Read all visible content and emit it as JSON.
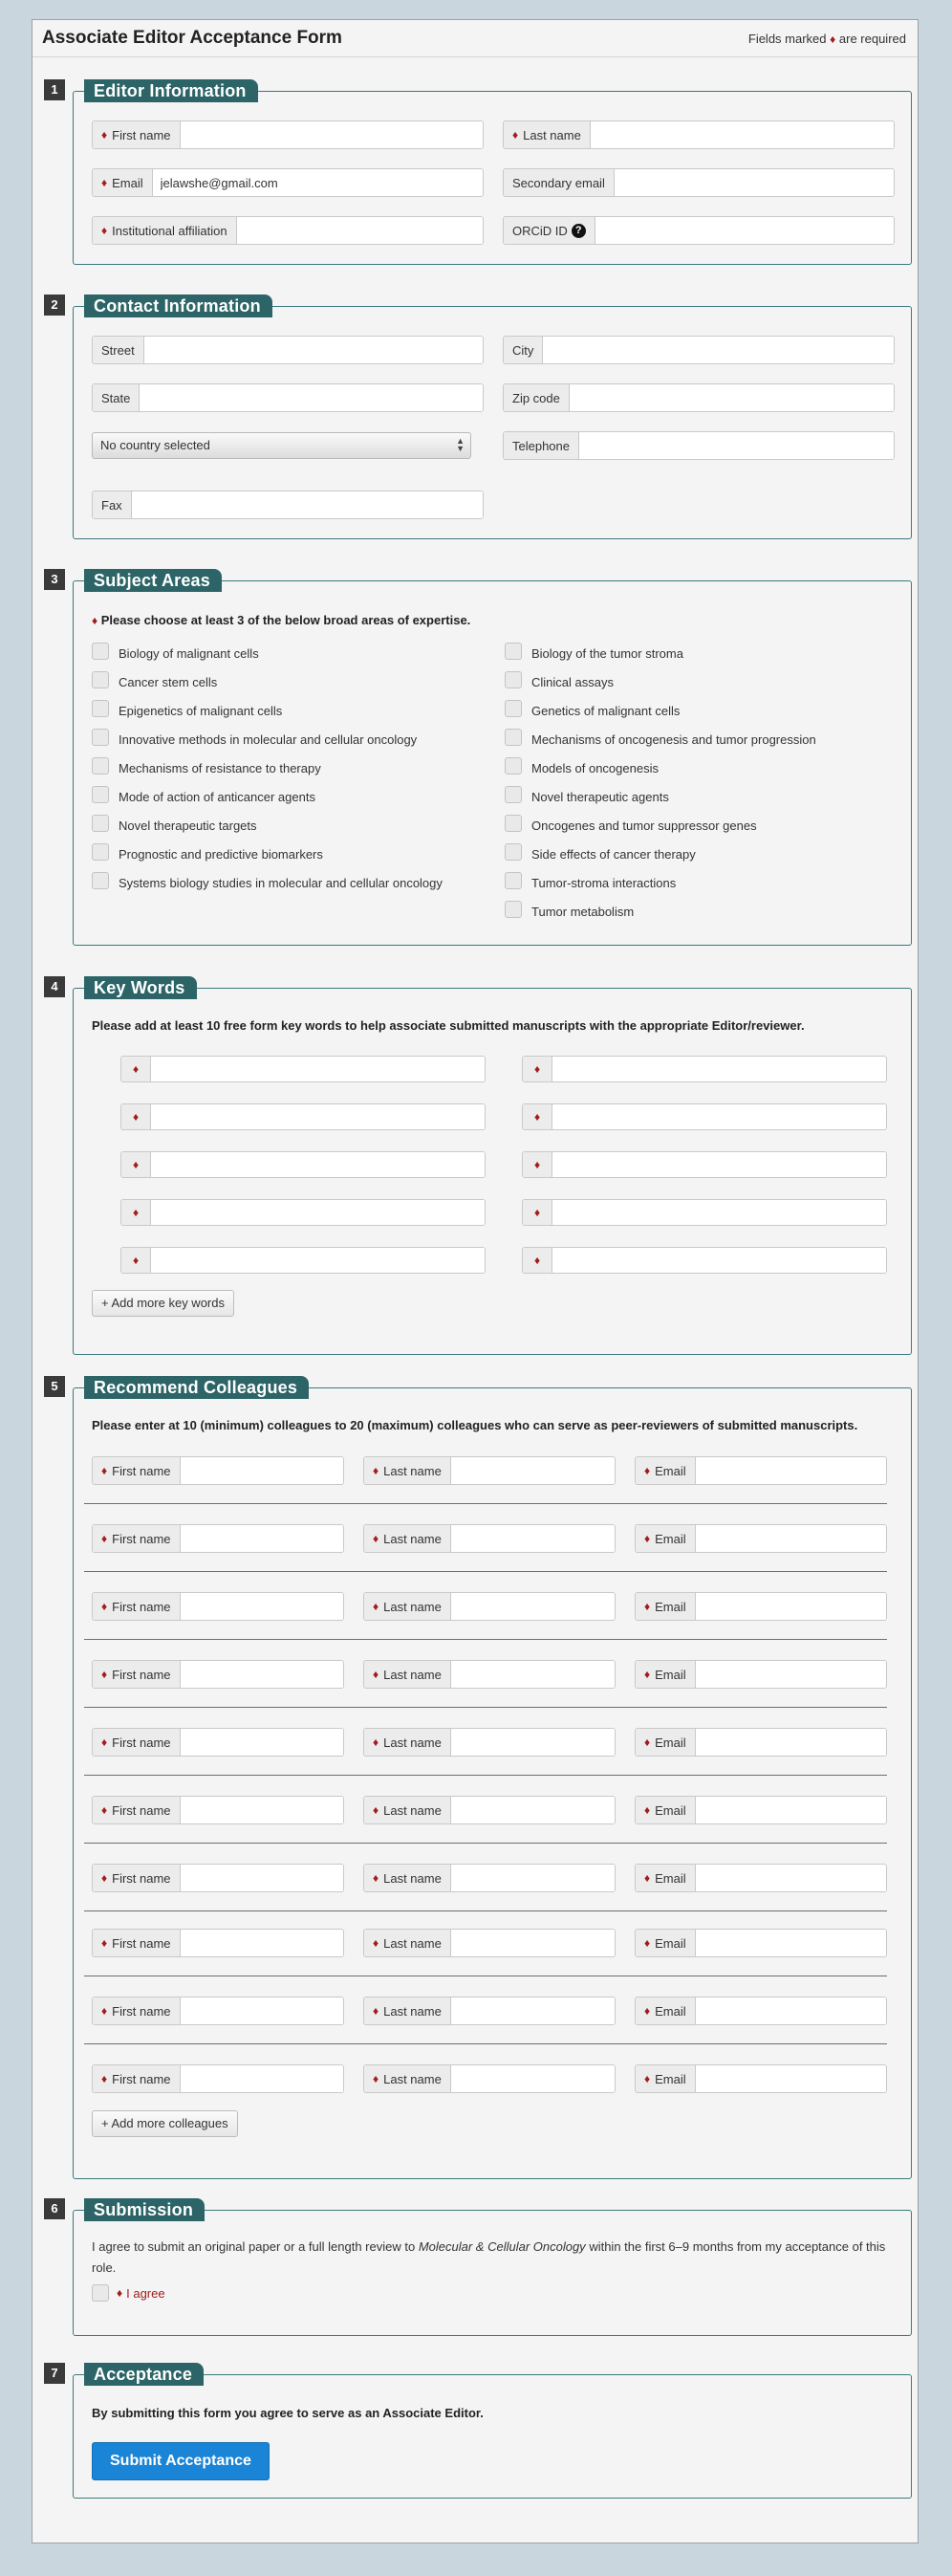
{
  "form": {
    "title": "Associate Editor Acceptance Form",
    "required_note_prefix": "Fields marked",
    "required_note_suffix": "are required",
    "required_marker": "♦"
  },
  "sections": {
    "editor": {
      "number": "1",
      "title": "Editor Information",
      "fields": {
        "first_name": {
          "label": "First name",
          "value": ""
        },
        "last_name": {
          "label": "Last name",
          "value": ""
        },
        "email": {
          "label": "Email",
          "value": "jelawshe@gmail.com"
        },
        "secondary_email": {
          "label": "Secondary email",
          "value": ""
        },
        "affiliation": {
          "label": "Institutional affiliation",
          "value": ""
        },
        "orcid": {
          "label": "ORCiD ID",
          "value": "",
          "help": "?"
        }
      }
    },
    "contact": {
      "number": "2",
      "title": "Contact Information",
      "fields": {
        "street": {
          "label": "Street",
          "value": ""
        },
        "city": {
          "label": "City",
          "value": ""
        },
        "state": {
          "label": "State",
          "value": ""
        },
        "zip": {
          "label": "Zip code",
          "value": ""
        },
        "country": {
          "selected": "No country selected"
        },
        "telephone": {
          "label": "Telephone",
          "value": ""
        },
        "fax": {
          "label": "Fax",
          "value": ""
        }
      }
    },
    "subject": {
      "number": "3",
      "title": "Subject Areas",
      "instruction": "Please choose at least 3 of the below broad areas of expertise.",
      "left": [
        "Biology of malignant cells",
        "Cancer stem cells",
        "Epigenetics of malignant cells",
        "Innovative methods in molecular and cellular oncology",
        "Mechanisms of resistance to therapy",
        "Mode of action of anticancer agents",
        "Novel therapeutic targets",
        "Prognostic and predictive biomarkers",
        "Systems biology studies in molecular and cellular oncology"
      ],
      "right": [
        "Biology of the tumor stroma",
        "Clinical assays",
        "Genetics of malignant cells",
        "Mechanisms of oncogenesis and tumor progression",
        "Models of oncogenesis",
        "Novel therapeutic agents",
        "Oncogenes and tumor suppressor genes",
        "Side effects of cancer therapy",
        "Tumor-stroma interactions",
        "Tumor metabolism"
      ]
    },
    "keywords": {
      "number": "4",
      "title": "Key Words",
      "instruction": "Please add at least 10 free form key words to help associate submitted manuscripts with the appropriate Editor/reviewer.",
      "add_button": "+ Add more key words"
    },
    "colleagues": {
      "number": "5",
      "title": "Recommend Colleagues",
      "instruction": "Please enter at 10 (minimum) colleagues to 20 (maximum) colleagues who can serve as peer-reviewers of submitted manuscripts.",
      "labels": {
        "first": "First name",
        "last": "Last name",
        "email": "Email"
      },
      "add_button": "+ Add more colleagues"
    },
    "submission": {
      "number": "6",
      "title": "Submission",
      "text_before": "I agree to submit an original paper or a full length review to",
      "journal": "Molecular & Cellular Oncology",
      "text_after": "within the first 6–9 months from my acceptance of this role.",
      "agree_label": "I agree"
    },
    "acceptance": {
      "number": "7",
      "title": "Acceptance",
      "text": "By submitting this form you agree to serve as an Associate Editor.",
      "submit_label": "Submit Acceptance"
    }
  }
}
